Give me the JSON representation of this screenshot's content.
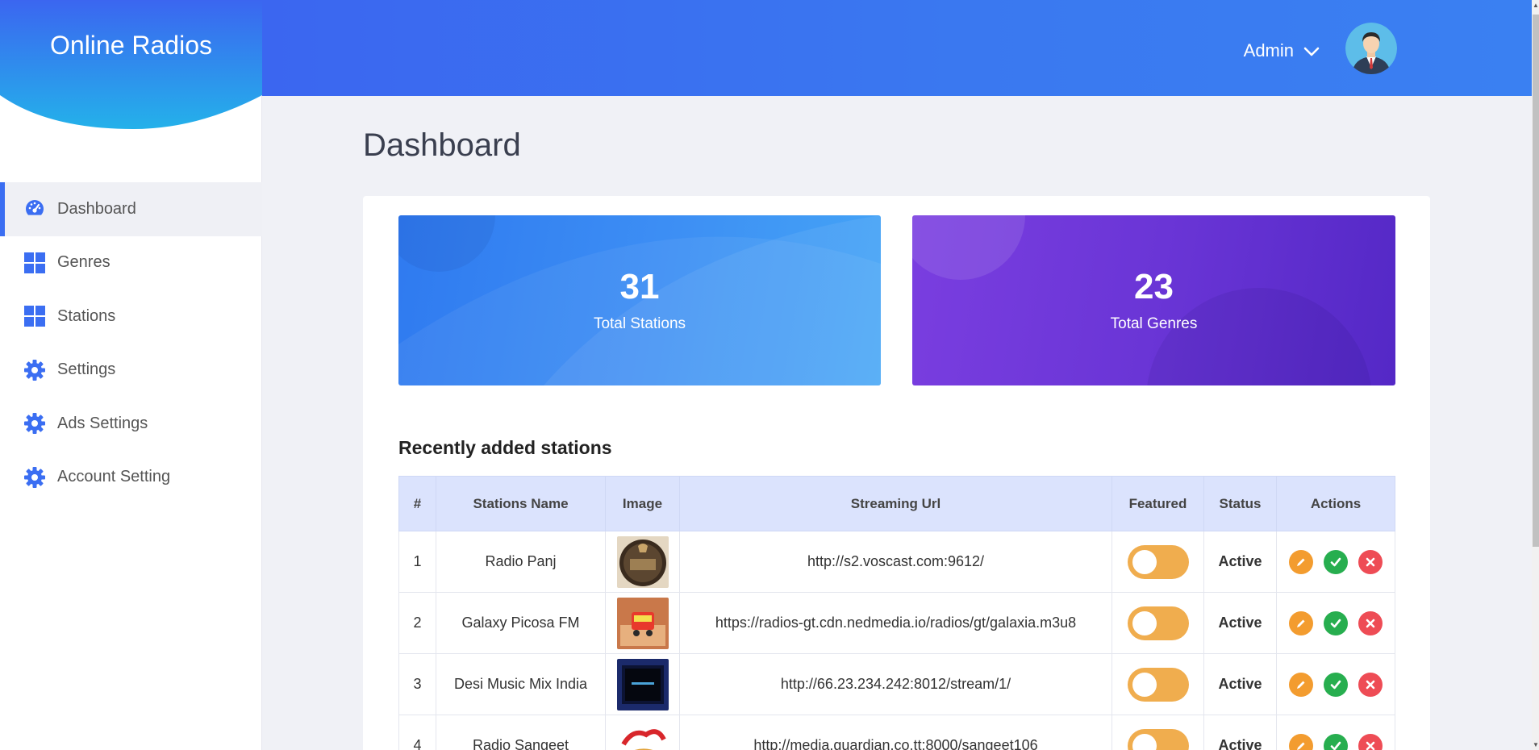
{
  "app": {
    "title": "Online Radios"
  },
  "header": {
    "user_label": "Admin"
  },
  "sidebar": {
    "items": [
      {
        "label": "Dashboard",
        "icon": "dashboard-gauge-icon",
        "active": true
      },
      {
        "label": "Genres",
        "icon": "grid-icon"
      },
      {
        "label": "Stations",
        "icon": "grid-icon"
      },
      {
        "label": "Settings",
        "icon": "gear-icon"
      },
      {
        "label": "Ads Settings",
        "icon": "gear-icon"
      },
      {
        "label": "Account Setting",
        "icon": "gear-icon"
      }
    ]
  },
  "main": {
    "title": "Dashboard",
    "stats": [
      {
        "value": "31",
        "label": "Total Stations",
        "color": "#3a86f2"
      },
      {
        "value": "23",
        "label": "Total Genres",
        "color": "#6a35d6"
      }
    ],
    "section_title": "Recently added stations",
    "table": {
      "headers": [
        "#",
        "Stations Name",
        "Image",
        "Streaming Url",
        "Featured",
        "Status",
        "Actions"
      ],
      "rows": [
        {
          "num": "1",
          "name": "Radio Panj",
          "url": "http://s2.voscast.com:9612/",
          "featured": false,
          "status": "Active"
        },
        {
          "num": "2",
          "name": "Galaxy Picosa FM",
          "url": "https://radios-gt.cdn.nedmedia.io/radios/gt/galaxia.m3u8",
          "featured": false,
          "status": "Active"
        },
        {
          "num": "3",
          "name": "Desi Music Mix India",
          "url": "http://66.23.234.242:8012/stream/1/",
          "featured": false,
          "status": "Active"
        },
        {
          "num": "4",
          "name": "Radio Sangeet",
          "url": "http://media.guardian.co.tt:8000/sangeet106",
          "featured": false,
          "status": "Active"
        }
      ]
    }
  },
  "colors": {
    "accent": "#3b6ef2",
    "toggle_off": "#f0ad4e",
    "status_active": "#28a745",
    "edit": "#f39c2f",
    "approve": "#27ae4f",
    "delete": "#ee4c55"
  }
}
